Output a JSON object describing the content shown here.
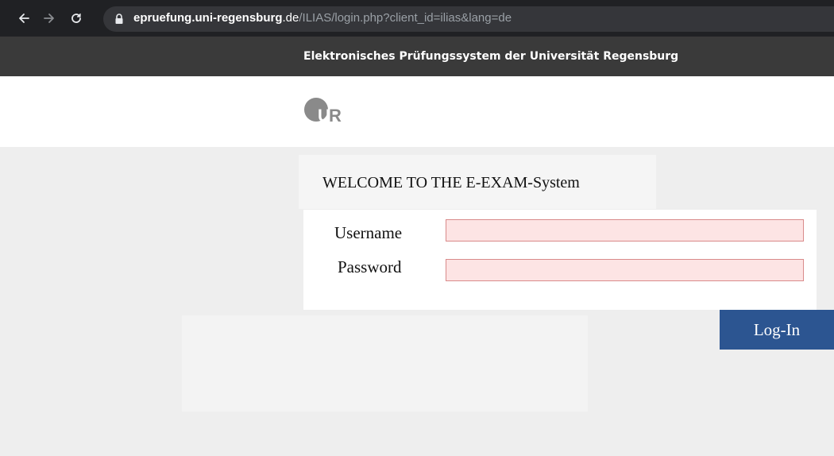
{
  "browser": {
    "url_host": "epruefung.uni-regensburg",
    "url_tld": ".de",
    "url_path": "/ILIAS/login.php?client_id=ilias&lang=de",
    "icons": [
      "back-arrow-icon",
      "forward-arrow-icon",
      "reload-icon",
      "lock-icon"
    ]
  },
  "header": {
    "title": "Elektronisches Prüfungssystem der Universität Regensburg"
  },
  "logo": {
    "text": "UR",
    "color": "#8a8a8a"
  },
  "welcome": {
    "text": "WELCOME TO THE E-EXAM-System"
  },
  "login_form": {
    "username_label": "Username",
    "username_value": "",
    "password_label": "Password",
    "password_value": "",
    "submit_label": "Log-In"
  },
  "colors": {
    "header_bg": "#3a3a3a",
    "content_bg": "#eeeeee",
    "input_bg": "#fde4e4",
    "input_border": "#d98a8a",
    "button_bg": "#2c5591"
  }
}
